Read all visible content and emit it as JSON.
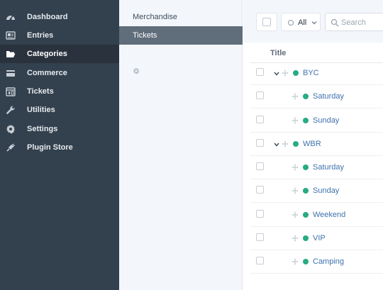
{
  "sidebar": {
    "items": [
      {
        "name": "dashboard",
        "label": "Dashboard",
        "icon": "gauge-icon"
      },
      {
        "name": "entries",
        "label": "Entries",
        "icon": "newspaper-icon"
      },
      {
        "name": "categories",
        "label": "Categories",
        "icon": "folder-open-icon",
        "active": true
      },
      {
        "name": "commerce",
        "label": "Commerce",
        "icon": "credit-card-icon"
      },
      {
        "name": "tickets",
        "label": "Tickets",
        "icon": "calendar-icon"
      },
      {
        "name": "utilities",
        "label": "Utilities",
        "icon": "wrench-icon"
      },
      {
        "name": "settings",
        "label": "Settings",
        "icon": "gear-icon"
      },
      {
        "name": "plugin-store",
        "label": "Plugin Store",
        "icon": "plug-icon"
      }
    ]
  },
  "sources": {
    "items": [
      {
        "label": "Merchandise"
      },
      {
        "label": "Tickets",
        "active": true
      }
    ]
  },
  "toolbar": {
    "status_label": "All",
    "search_placeholder": "Search"
  },
  "table": {
    "column_title": "Title",
    "rows": [
      {
        "title": "BYC",
        "level": 1,
        "expandable": true,
        "status": "enabled"
      },
      {
        "title": "Saturday",
        "level": 2,
        "status": "enabled"
      },
      {
        "title": "Sunday",
        "level": 2,
        "status": "enabled"
      },
      {
        "title": "WBR",
        "level": 1,
        "expandable": true,
        "status": "enabled"
      },
      {
        "title": "Saturday",
        "level": 2,
        "status": "enabled"
      },
      {
        "title": "Sunday",
        "level": 2,
        "status": "enabled"
      },
      {
        "title": "Weekend",
        "level": 2,
        "status": "enabled"
      },
      {
        "title": "VIP",
        "level": 2,
        "status": "enabled"
      },
      {
        "title": "Camping",
        "level": 2,
        "status": "enabled"
      }
    ]
  },
  "colors": {
    "sidebar_bg": "#33404d",
    "sidebar_active": "#29323d",
    "source_active": "#606d7b",
    "link": "#3f72ad",
    "status_enabled": "#27ab83"
  }
}
